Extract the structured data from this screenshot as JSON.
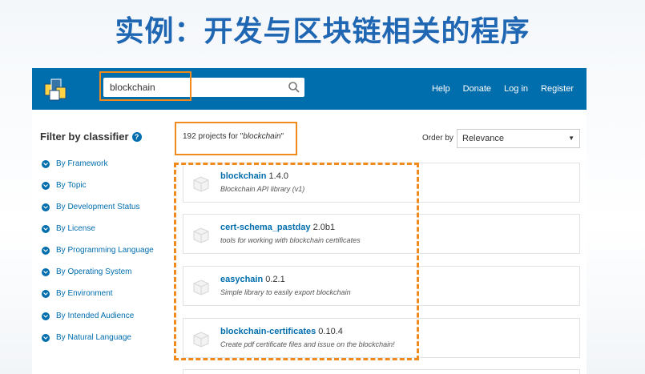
{
  "slide": {
    "title": "实例：开发与区块链相关的程序"
  },
  "header": {
    "search": {
      "value": "blockchain",
      "placeholder": ""
    },
    "nav": [
      "Help",
      "Donate",
      "Log in",
      "Register"
    ]
  },
  "sidebar": {
    "title": "Filter by classifier",
    "items": [
      "By Framework",
      "By Topic",
      "By Development Status",
      "By License",
      "By Programming Language",
      "By Operating System",
      "By Environment",
      "By Intended Audience",
      "By Natural Language"
    ]
  },
  "results": {
    "count_prefix": "192 projects for \"",
    "query": "blockchain",
    "count_suffix": "\"",
    "order_label": "Order by",
    "order_value": "Relevance",
    "items": [
      {
        "name": "blockchain",
        "version": "1.4.0",
        "description": "Blockchain API library (v1)"
      },
      {
        "name": "cert-schema_pastday",
        "version": "2.0b1",
        "description": "tools for working with blockchain certificates"
      },
      {
        "name": "easychain",
        "version": "0.2.1",
        "description": "Simple library to easily export blockchain"
      },
      {
        "name": "blockchain-certificates",
        "version": "0.10.4",
        "description": "Create pdf certificate files and issue on the blockchain!"
      }
    ]
  },
  "colors": {
    "title": "#1f66b3",
    "brand_blue": "#006dad",
    "highlight_orange": "#f08a1c"
  }
}
